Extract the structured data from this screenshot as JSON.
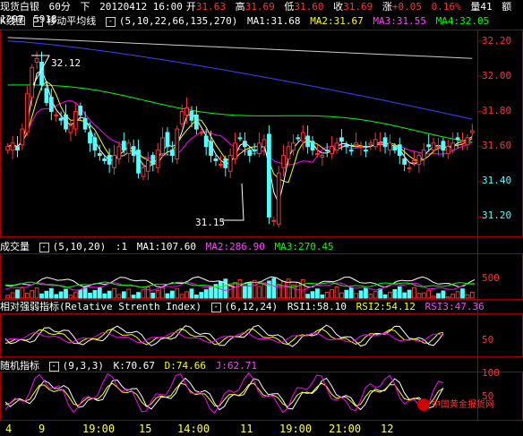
{
  "header": {
    "symbol": "现货白银",
    "period": "60分",
    "label_xia": "下",
    "date_time": "20120412 16:00",
    "kai_label": "开",
    "open": "31.63",
    "gao_label": "高",
    "high": "31.69",
    "di_label": "低",
    "low": "31.60",
    "shou_label": "收",
    "close": "31.69",
    "zhang_label": "涨",
    "change": "+0.05",
    "change_pct": "0.16%",
    "volume_label": "量41",
    "amount_label": "额1297",
    "amount_value": "5918"
  },
  "main_panel": {
    "title_kline": "K线图",
    "title_ma": "移动平均线",
    "params": "(5,10,22,66,135,270)",
    "ma1": "MA1:31.68",
    "ma2": "MA2:31.67",
    "ma3": "MA3:31.55",
    "ma4": "MA4:32.05",
    "high_note": "32.12",
    "low_note": "31.15",
    "y_ticks": [
      "32.20",
      "32.00",
      "31.80",
      "31.60",
      "31.40",
      "31.20"
    ]
  },
  "volume_panel": {
    "title": "成交量",
    "params": "(5,10,20)",
    "prefix": ":1",
    "ma1": "MA1:107.60",
    "ma2": "MA2:286.90",
    "ma3": "MA3:270.45",
    "y_ticks": [
      "500"
    ]
  },
  "rsi_panel": {
    "title": "相对强弱指标(Relative Strenth Index)",
    "params": "(6,12,24)",
    "rsi1": "RSI1:58.10",
    "rsi2": "RSI2:54.12",
    "rsi3": "RSI3:47.36",
    "y_ticks": [
      "50"
    ]
  },
  "kdj_panel": {
    "title": "随机指标",
    "params": "(9,3,3)",
    "k": "K:70.67",
    "d": "D:74.66",
    "j": "J:62.71",
    "y_ticks": [
      "100",
      "50"
    ]
  },
  "x_axis": [
    "4",
    "9",
    "19:00",
    "15",
    "14:00",
    "11",
    "19:00",
    "21:00",
    "12"
  ],
  "watermark": "中国黄金报货网",
  "colors": {
    "up": "#ff3232",
    "down": "#54fcfc",
    "ma1": "#ffffff",
    "ma2": "#ffff00",
    "ma3": "#ff00ff",
    "ma4": "#00ff00",
    "ma_long": "#4040ff",
    "frame": "#a00000"
  },
  "chart_data": {
    "type": "candlestick",
    "price_range": [
      31.1,
      32.25
    ],
    "closes": [
      31.6,
      31.62,
      31.58,
      31.7,
      31.9,
      32.05,
      32.1,
      31.95,
      31.85,
      31.8,
      31.78,
      31.75,
      31.7,
      31.72,
      31.8,
      31.78,
      31.7,
      31.62,
      31.58,
      31.55,
      31.52,
      31.5,
      31.55,
      31.6,
      31.58,
      31.62,
      31.55,
      31.45,
      31.48,
      31.52,
      31.5,
      31.58,
      31.65,
      31.6,
      31.55,
      31.7,
      31.8,
      31.82,
      31.75,
      31.7,
      31.68,
      31.6,
      31.55,
      31.52,
      31.5,
      31.48,
      31.55,
      31.62,
      31.65,
      31.6,
      31.55,
      31.58,
      31.62,
      31.64,
      31.2,
      31.18,
      31.45,
      31.55,
      31.6,
      31.62,
      31.65,
      31.68,
      31.6,
      31.58,
      31.56,
      31.55,
      31.58,
      31.6,
      31.62,
      31.63,
      31.6,
      31.58,
      31.62,
      31.6,
      31.58,
      31.62,
      31.64,
      31.62,
      31.6,
      31.62,
      31.58,
      31.55,
      31.5,
      31.48,
      31.52,
      31.55,
      31.58,
      31.6,
      31.62,
      31.6,
      31.58,
      31.6,
      31.62,
      31.64,
      31.63,
      31.65,
      31.69
    ]
  }
}
